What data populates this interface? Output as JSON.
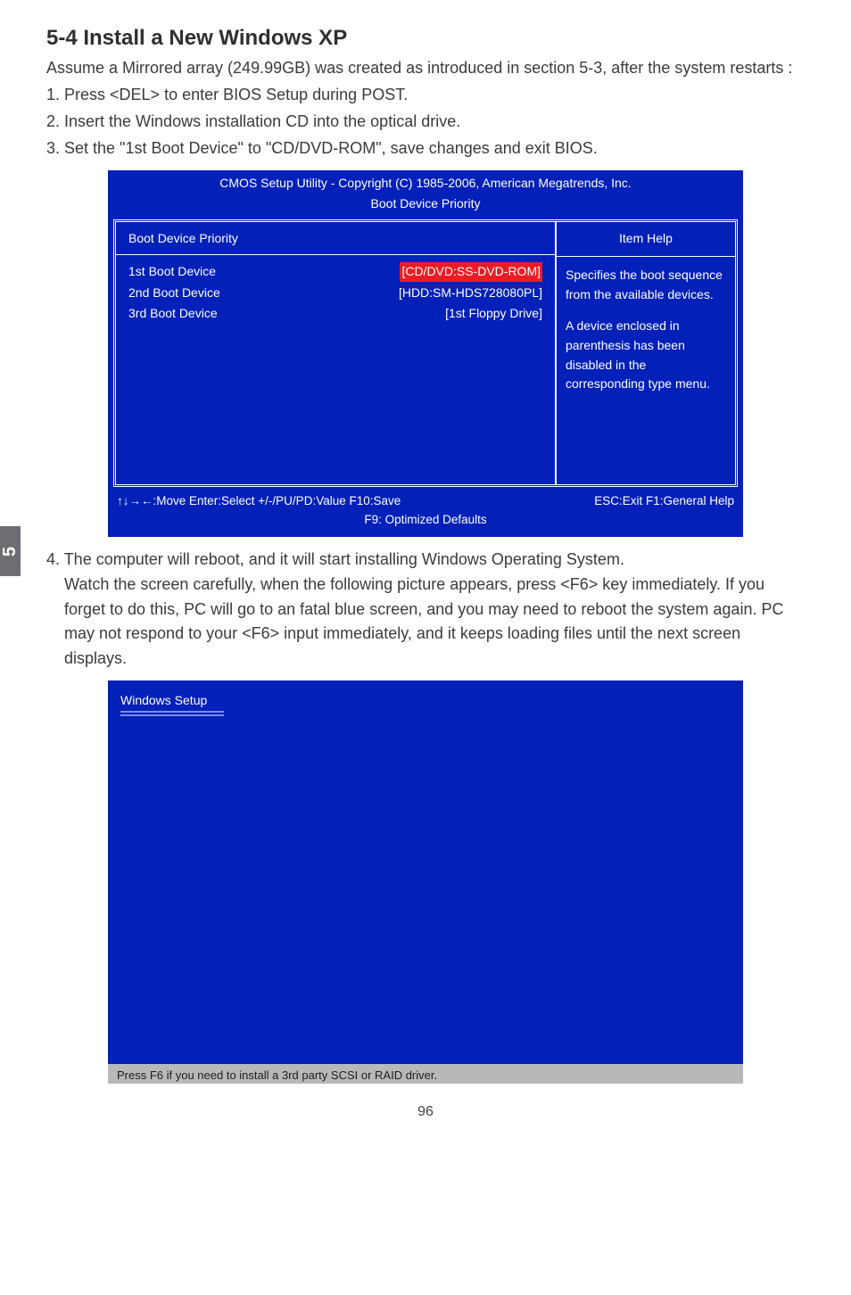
{
  "side_tab": "5",
  "section_title": "5-4 Install a New Windows XP",
  "intro1": "Assume a Mirrored array (249.99GB) was created as introduced in section 5-3, after the system restarts :",
  "step1": "1. Press <DEL> to enter BIOS Setup during POST.",
  "step2": "2. Insert the Windows installation CD into the optical drive.",
  "step3": "3. Set the \"1st Boot Device\" to \"CD/DVD-ROM\", save changes and exit BIOS.",
  "bios": {
    "title": "CMOS Setup Utility - Copyright (C) 1985-2006, American Megatrends, Inc.",
    "subtitle": "Boot Device Priority",
    "left_header": "Boot Device Priority",
    "right_header": "Item Help",
    "rows": [
      {
        "label": "1st Boot Device",
        "value": "[CD/DVD:SS-DVD-ROM]",
        "selected": true
      },
      {
        "label": "2nd Boot Device",
        "value": "[HDD:SM-HDS728080PL]",
        "selected": false
      },
      {
        "label": "3rd Boot Device",
        "value": "[1st Floppy Drive]",
        "selected": false
      }
    ],
    "help_p1": "Specifies the boot sequence from the available devices.",
    "help_p2": "A device enclosed in parenthesis has been disabled in the corresponding type menu.",
    "footer_left": "↑↓→←:Move   Enter:Select    +/-/PU/PD:Value   F10:Save",
    "footer_right": "ESC:Exit   F1:General Help",
    "footer_line2": "F9: Optimized Defaults"
  },
  "step4a": "4. The computer will reboot, and it will start installing Windows Operating System.",
  "step4b": "Watch the screen carefully, when the following picture appears, press <F6> key immediately. If you forget to do this, PC will go to an fatal blue screen, and you may need to reboot the system again. PC may not respond to your <F6> input immediately, and it keeps loading files until the next screen displays.",
  "winsetup": {
    "title": "Windows Setup",
    "status": "Press F6 if you need to install a 3rd party SCSI or RAID driver."
  },
  "page_number": "96"
}
